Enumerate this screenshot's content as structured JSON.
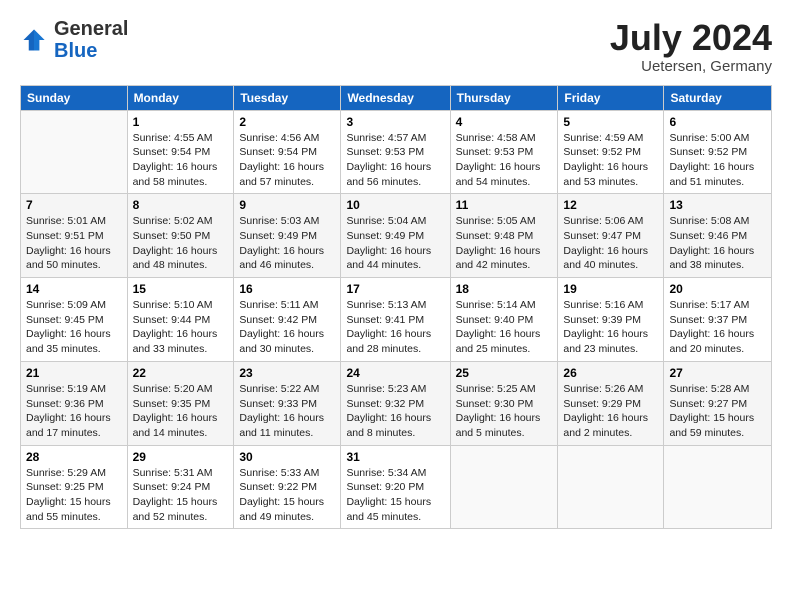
{
  "header": {
    "logo_general": "General",
    "logo_blue": "Blue",
    "month_title": "July 2024",
    "location": "Uetersen, Germany"
  },
  "weekdays": [
    "Sunday",
    "Monday",
    "Tuesday",
    "Wednesday",
    "Thursday",
    "Friday",
    "Saturday"
  ],
  "weeks": [
    [
      {
        "num": "",
        "info": ""
      },
      {
        "num": "1",
        "info": "Sunrise: 4:55 AM\nSunset: 9:54 PM\nDaylight: 16 hours\nand 58 minutes."
      },
      {
        "num": "2",
        "info": "Sunrise: 4:56 AM\nSunset: 9:54 PM\nDaylight: 16 hours\nand 57 minutes."
      },
      {
        "num": "3",
        "info": "Sunrise: 4:57 AM\nSunset: 9:53 PM\nDaylight: 16 hours\nand 56 minutes."
      },
      {
        "num": "4",
        "info": "Sunrise: 4:58 AM\nSunset: 9:53 PM\nDaylight: 16 hours\nand 54 minutes."
      },
      {
        "num": "5",
        "info": "Sunrise: 4:59 AM\nSunset: 9:52 PM\nDaylight: 16 hours\nand 53 minutes."
      },
      {
        "num": "6",
        "info": "Sunrise: 5:00 AM\nSunset: 9:52 PM\nDaylight: 16 hours\nand 51 minutes."
      }
    ],
    [
      {
        "num": "7",
        "info": "Sunrise: 5:01 AM\nSunset: 9:51 PM\nDaylight: 16 hours\nand 50 minutes."
      },
      {
        "num": "8",
        "info": "Sunrise: 5:02 AM\nSunset: 9:50 PM\nDaylight: 16 hours\nand 48 minutes."
      },
      {
        "num": "9",
        "info": "Sunrise: 5:03 AM\nSunset: 9:49 PM\nDaylight: 16 hours\nand 46 minutes."
      },
      {
        "num": "10",
        "info": "Sunrise: 5:04 AM\nSunset: 9:49 PM\nDaylight: 16 hours\nand 44 minutes."
      },
      {
        "num": "11",
        "info": "Sunrise: 5:05 AM\nSunset: 9:48 PM\nDaylight: 16 hours\nand 42 minutes."
      },
      {
        "num": "12",
        "info": "Sunrise: 5:06 AM\nSunset: 9:47 PM\nDaylight: 16 hours\nand 40 minutes."
      },
      {
        "num": "13",
        "info": "Sunrise: 5:08 AM\nSunset: 9:46 PM\nDaylight: 16 hours\nand 38 minutes."
      }
    ],
    [
      {
        "num": "14",
        "info": "Sunrise: 5:09 AM\nSunset: 9:45 PM\nDaylight: 16 hours\nand 35 minutes."
      },
      {
        "num": "15",
        "info": "Sunrise: 5:10 AM\nSunset: 9:44 PM\nDaylight: 16 hours\nand 33 minutes."
      },
      {
        "num": "16",
        "info": "Sunrise: 5:11 AM\nSunset: 9:42 PM\nDaylight: 16 hours\nand 30 minutes."
      },
      {
        "num": "17",
        "info": "Sunrise: 5:13 AM\nSunset: 9:41 PM\nDaylight: 16 hours\nand 28 minutes."
      },
      {
        "num": "18",
        "info": "Sunrise: 5:14 AM\nSunset: 9:40 PM\nDaylight: 16 hours\nand 25 minutes."
      },
      {
        "num": "19",
        "info": "Sunrise: 5:16 AM\nSunset: 9:39 PM\nDaylight: 16 hours\nand 23 minutes."
      },
      {
        "num": "20",
        "info": "Sunrise: 5:17 AM\nSunset: 9:37 PM\nDaylight: 16 hours\nand 20 minutes."
      }
    ],
    [
      {
        "num": "21",
        "info": "Sunrise: 5:19 AM\nSunset: 9:36 PM\nDaylight: 16 hours\nand 17 minutes."
      },
      {
        "num": "22",
        "info": "Sunrise: 5:20 AM\nSunset: 9:35 PM\nDaylight: 16 hours\nand 14 minutes."
      },
      {
        "num": "23",
        "info": "Sunrise: 5:22 AM\nSunset: 9:33 PM\nDaylight: 16 hours\nand 11 minutes."
      },
      {
        "num": "24",
        "info": "Sunrise: 5:23 AM\nSunset: 9:32 PM\nDaylight: 16 hours\nand 8 minutes."
      },
      {
        "num": "25",
        "info": "Sunrise: 5:25 AM\nSunset: 9:30 PM\nDaylight: 16 hours\nand 5 minutes."
      },
      {
        "num": "26",
        "info": "Sunrise: 5:26 AM\nSunset: 9:29 PM\nDaylight: 16 hours\nand 2 minutes."
      },
      {
        "num": "27",
        "info": "Sunrise: 5:28 AM\nSunset: 9:27 PM\nDaylight: 15 hours\nand 59 minutes."
      }
    ],
    [
      {
        "num": "28",
        "info": "Sunrise: 5:29 AM\nSunset: 9:25 PM\nDaylight: 15 hours\nand 55 minutes."
      },
      {
        "num": "29",
        "info": "Sunrise: 5:31 AM\nSunset: 9:24 PM\nDaylight: 15 hours\nand 52 minutes."
      },
      {
        "num": "30",
        "info": "Sunrise: 5:33 AM\nSunset: 9:22 PM\nDaylight: 15 hours\nand 49 minutes."
      },
      {
        "num": "31",
        "info": "Sunrise: 5:34 AM\nSunset: 9:20 PM\nDaylight: 15 hours\nand 45 minutes."
      },
      {
        "num": "",
        "info": ""
      },
      {
        "num": "",
        "info": ""
      },
      {
        "num": "",
        "info": ""
      }
    ]
  ]
}
